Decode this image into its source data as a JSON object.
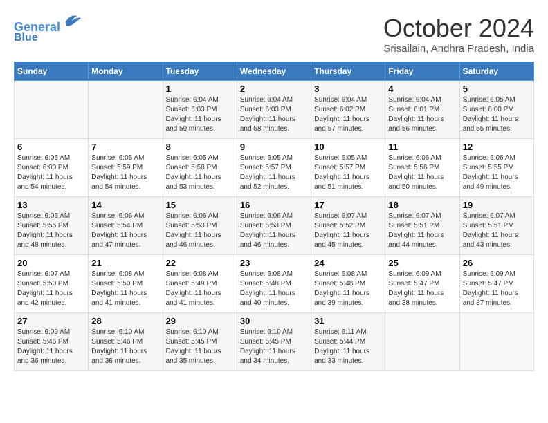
{
  "header": {
    "logo_line1": "General",
    "logo_line2": "Blue",
    "month": "October 2024",
    "location": "Srisailain, Andhra Pradesh, India"
  },
  "weekdays": [
    "Sunday",
    "Monday",
    "Tuesday",
    "Wednesday",
    "Thursday",
    "Friday",
    "Saturday"
  ],
  "weeks": [
    [
      {
        "day": "",
        "sunrise": "",
        "sunset": "",
        "daylight": ""
      },
      {
        "day": "",
        "sunrise": "",
        "sunset": "",
        "daylight": ""
      },
      {
        "day": "1",
        "sunrise": "Sunrise: 6:04 AM",
        "sunset": "Sunset: 6:03 PM",
        "daylight": "Daylight: 11 hours and 59 minutes."
      },
      {
        "day": "2",
        "sunrise": "Sunrise: 6:04 AM",
        "sunset": "Sunset: 6:03 PM",
        "daylight": "Daylight: 11 hours and 58 minutes."
      },
      {
        "day": "3",
        "sunrise": "Sunrise: 6:04 AM",
        "sunset": "Sunset: 6:02 PM",
        "daylight": "Daylight: 11 hours and 57 minutes."
      },
      {
        "day": "4",
        "sunrise": "Sunrise: 6:04 AM",
        "sunset": "Sunset: 6:01 PM",
        "daylight": "Daylight: 11 hours and 56 minutes."
      },
      {
        "day": "5",
        "sunrise": "Sunrise: 6:05 AM",
        "sunset": "Sunset: 6:00 PM",
        "daylight": "Daylight: 11 hours and 55 minutes."
      }
    ],
    [
      {
        "day": "6",
        "sunrise": "Sunrise: 6:05 AM",
        "sunset": "Sunset: 6:00 PM",
        "daylight": "Daylight: 11 hours and 54 minutes."
      },
      {
        "day": "7",
        "sunrise": "Sunrise: 6:05 AM",
        "sunset": "Sunset: 5:59 PM",
        "daylight": "Daylight: 11 hours and 54 minutes."
      },
      {
        "day": "8",
        "sunrise": "Sunrise: 6:05 AM",
        "sunset": "Sunset: 5:58 PM",
        "daylight": "Daylight: 11 hours and 53 minutes."
      },
      {
        "day": "9",
        "sunrise": "Sunrise: 6:05 AM",
        "sunset": "Sunset: 5:57 PM",
        "daylight": "Daylight: 11 hours and 52 minutes."
      },
      {
        "day": "10",
        "sunrise": "Sunrise: 6:05 AM",
        "sunset": "Sunset: 5:57 PM",
        "daylight": "Daylight: 11 hours and 51 minutes."
      },
      {
        "day": "11",
        "sunrise": "Sunrise: 6:06 AM",
        "sunset": "Sunset: 5:56 PM",
        "daylight": "Daylight: 11 hours and 50 minutes."
      },
      {
        "day": "12",
        "sunrise": "Sunrise: 6:06 AM",
        "sunset": "Sunset: 5:55 PM",
        "daylight": "Daylight: 11 hours and 49 minutes."
      }
    ],
    [
      {
        "day": "13",
        "sunrise": "Sunrise: 6:06 AM",
        "sunset": "Sunset: 5:55 PM",
        "daylight": "Daylight: 11 hours and 48 minutes."
      },
      {
        "day": "14",
        "sunrise": "Sunrise: 6:06 AM",
        "sunset": "Sunset: 5:54 PM",
        "daylight": "Daylight: 11 hours and 47 minutes."
      },
      {
        "day": "15",
        "sunrise": "Sunrise: 6:06 AM",
        "sunset": "Sunset: 5:53 PM",
        "daylight": "Daylight: 11 hours and 46 minutes."
      },
      {
        "day": "16",
        "sunrise": "Sunrise: 6:06 AM",
        "sunset": "Sunset: 5:53 PM",
        "daylight": "Daylight: 11 hours and 46 minutes."
      },
      {
        "day": "17",
        "sunrise": "Sunrise: 6:07 AM",
        "sunset": "Sunset: 5:52 PM",
        "daylight": "Daylight: 11 hours and 45 minutes."
      },
      {
        "day": "18",
        "sunrise": "Sunrise: 6:07 AM",
        "sunset": "Sunset: 5:51 PM",
        "daylight": "Daylight: 11 hours and 44 minutes."
      },
      {
        "day": "19",
        "sunrise": "Sunrise: 6:07 AM",
        "sunset": "Sunset: 5:51 PM",
        "daylight": "Daylight: 11 hours and 43 minutes."
      }
    ],
    [
      {
        "day": "20",
        "sunrise": "Sunrise: 6:07 AM",
        "sunset": "Sunset: 5:50 PM",
        "daylight": "Daylight: 11 hours and 42 minutes."
      },
      {
        "day": "21",
        "sunrise": "Sunrise: 6:08 AM",
        "sunset": "Sunset: 5:50 PM",
        "daylight": "Daylight: 11 hours and 41 minutes."
      },
      {
        "day": "22",
        "sunrise": "Sunrise: 6:08 AM",
        "sunset": "Sunset: 5:49 PM",
        "daylight": "Daylight: 11 hours and 41 minutes."
      },
      {
        "day": "23",
        "sunrise": "Sunrise: 6:08 AM",
        "sunset": "Sunset: 5:48 PM",
        "daylight": "Daylight: 11 hours and 40 minutes."
      },
      {
        "day": "24",
        "sunrise": "Sunrise: 6:08 AM",
        "sunset": "Sunset: 5:48 PM",
        "daylight": "Daylight: 11 hours and 39 minutes."
      },
      {
        "day": "25",
        "sunrise": "Sunrise: 6:09 AM",
        "sunset": "Sunset: 5:47 PM",
        "daylight": "Daylight: 11 hours and 38 minutes."
      },
      {
        "day": "26",
        "sunrise": "Sunrise: 6:09 AM",
        "sunset": "Sunset: 5:47 PM",
        "daylight": "Daylight: 11 hours and 37 minutes."
      }
    ],
    [
      {
        "day": "27",
        "sunrise": "Sunrise: 6:09 AM",
        "sunset": "Sunset: 5:46 PM",
        "daylight": "Daylight: 11 hours and 36 minutes."
      },
      {
        "day": "28",
        "sunrise": "Sunrise: 6:10 AM",
        "sunset": "Sunset: 5:46 PM",
        "daylight": "Daylight: 11 hours and 36 minutes."
      },
      {
        "day": "29",
        "sunrise": "Sunrise: 6:10 AM",
        "sunset": "Sunset: 5:45 PM",
        "daylight": "Daylight: 11 hours and 35 minutes."
      },
      {
        "day": "30",
        "sunrise": "Sunrise: 6:10 AM",
        "sunset": "Sunset: 5:45 PM",
        "daylight": "Daylight: 11 hours and 34 minutes."
      },
      {
        "day": "31",
        "sunrise": "Sunrise: 6:11 AM",
        "sunset": "Sunset: 5:44 PM",
        "daylight": "Daylight: 11 hours and 33 minutes."
      },
      {
        "day": "",
        "sunrise": "",
        "sunset": "",
        "daylight": ""
      },
      {
        "day": "",
        "sunrise": "",
        "sunset": "",
        "daylight": ""
      }
    ]
  ]
}
